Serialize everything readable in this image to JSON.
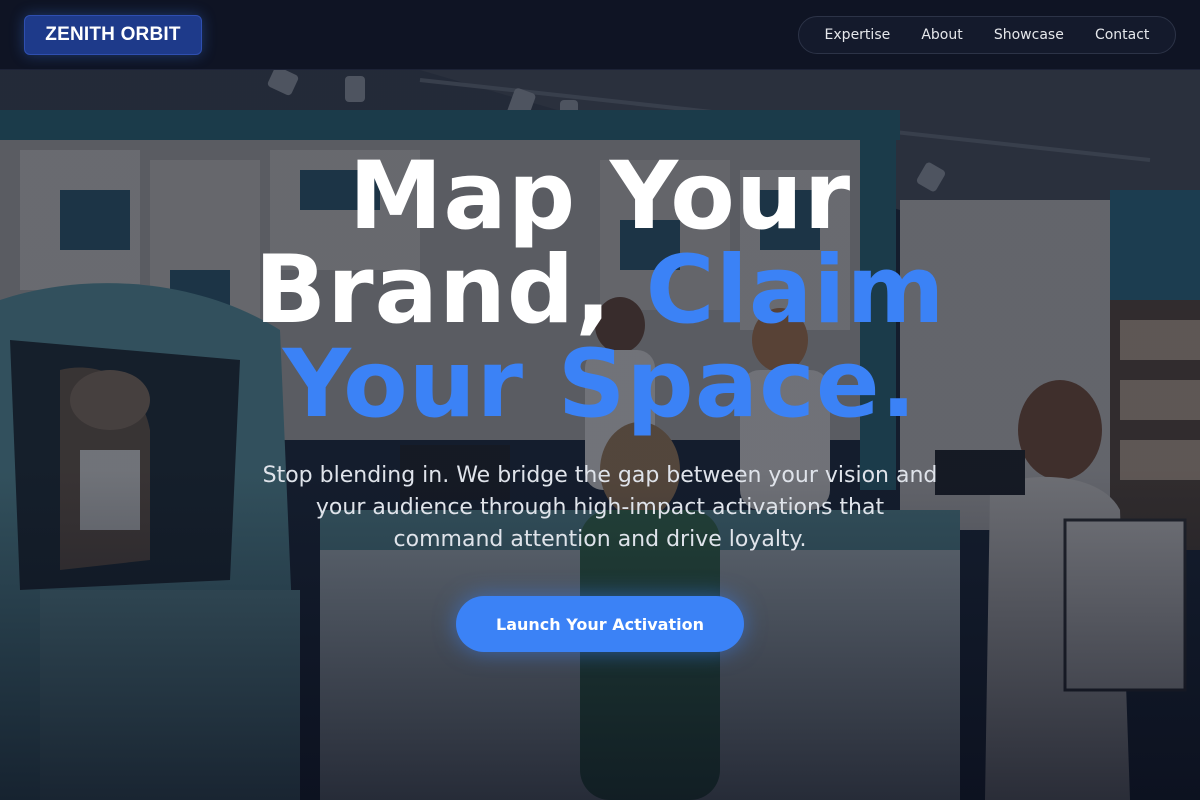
{
  "brand": {
    "name": "ZENITH ORBIT"
  },
  "nav": {
    "items": [
      {
        "label": "Expertise"
      },
      {
        "label": "About"
      },
      {
        "label": "Showcase"
      },
      {
        "label": "Contact"
      }
    ]
  },
  "hero": {
    "headline_line1": "Map Your",
    "headline_line2_white": "Brand, ",
    "headline_line2_accent": "Claim",
    "headline_line3_accent": "Your Space.",
    "subtext": "Stop blending in. We bridge the gap between your vision and your audience through high-impact activations that command attention and drive loyalty.",
    "cta_label": "Launch Your Activation"
  },
  "colors": {
    "accent": "#3b82f6",
    "header_bg": "#0f1424",
    "logo_bg": "#1e3a8a"
  }
}
